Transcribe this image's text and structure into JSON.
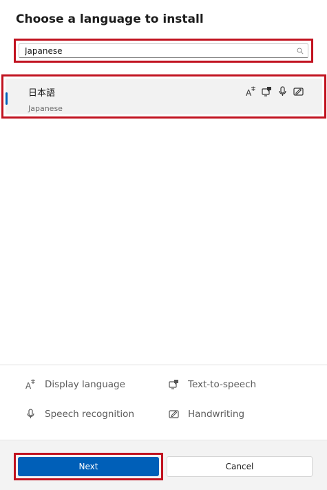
{
  "dialog": {
    "title": "Choose a language to install"
  },
  "search": {
    "value": "Japanese",
    "icon": "search-icon"
  },
  "languages": [
    {
      "native_name": "日本語",
      "english_name": "Japanese",
      "capabilities": [
        "display-language-icon",
        "text-to-speech-icon",
        "speech-recognition-icon",
        "handwriting-icon"
      ]
    }
  ],
  "legend": {
    "display_language": "Display language",
    "text_to_speech": "Text-to-speech",
    "speech_recognition": "Speech recognition",
    "handwriting": "Handwriting"
  },
  "buttons": {
    "next": "Next",
    "cancel": "Cancel"
  },
  "colors": {
    "accent": "#005fb8",
    "highlight": "#c1121f",
    "selected_bg": "#f2f2f2"
  }
}
